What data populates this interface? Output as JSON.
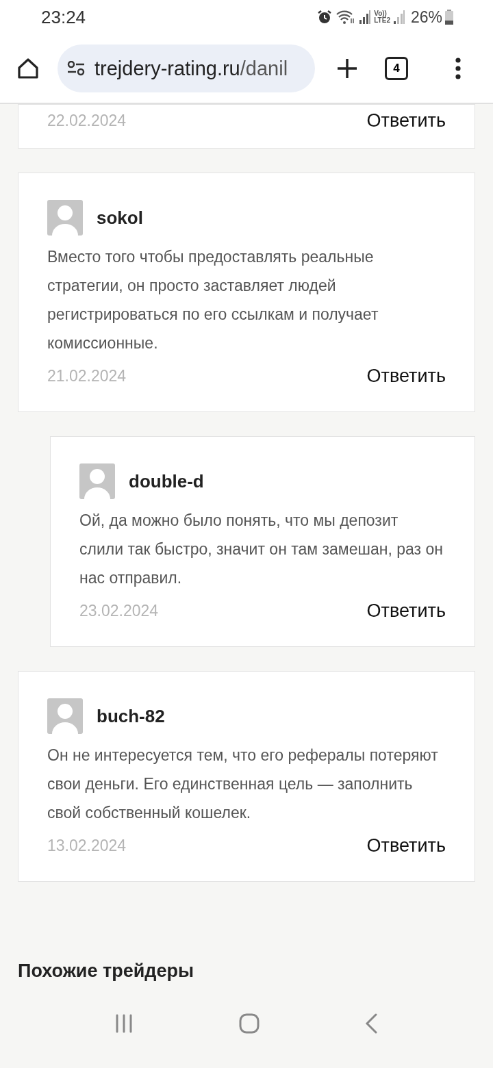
{
  "status_bar": {
    "time": "23:24",
    "volte_top": "Vo))",
    "volte_bottom": "LTE2",
    "battery": "26%"
  },
  "browser": {
    "url_host": "trejdery-rating.ru",
    "url_path": "/danil",
    "tab_count": "4"
  },
  "comments": [
    {
      "date": "22.02.2024",
      "reply": "Ответить"
    },
    {
      "author": "sokol",
      "text": "Вместо того чтобы предоставлять реальные стратегии, он просто заставляет людей регистрироваться по его ссылкам и получает комиссионные.",
      "date": "21.02.2024",
      "reply": "Ответить",
      "children": [
        {
          "author": "double-d",
          "text": "Ой, да можно было понять, что мы депозит слили так быстро, значит он там замешан, раз он нас отправил.",
          "date": "23.02.2024",
          "reply": "Ответить"
        }
      ]
    },
    {
      "author": "buch-82",
      "text": "Он не интересуется тем, что его рефералы потеряют свои деньги. Его единственная цель — заполнить свой собственный кошелек.",
      "date": "13.02.2024",
      "reply": "Ответить"
    }
  ],
  "section_title": "Похожие трейдеры"
}
